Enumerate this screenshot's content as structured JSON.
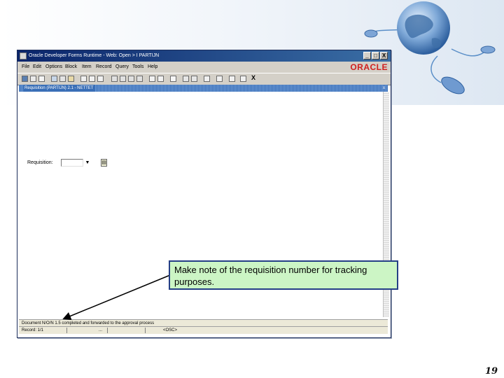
{
  "window": {
    "title": "Oracle Developer Forms Runtime - Web: Open > I PARTIJN",
    "controls": [
      "_",
      "□",
      "X"
    ],
    "menu": [
      "File",
      "Edit",
      "Options",
      "Block",
      "Item",
      "Record",
      "Query",
      "Tools",
      "Help"
    ],
    "brand": "ORACLE",
    "toolbar_x": "X",
    "inner_title": "Requisition (PARTIJN) 2.1 - NETTET",
    "inner_close": "x"
  },
  "form": {
    "requisition_label": "Requisition:",
    "requisition_value": "",
    "dropdown_glyph": "▼",
    "lov_glyph": "▤"
  },
  "status": {
    "message": "Document N/O/N 1.5 completed and forwarded to the approval process",
    "record": "Record: 1/1",
    "record_extra": "...",
    "mode": "<OSC>"
  },
  "callout": {
    "text": "Make note of the requisition number for tracking purposes."
  },
  "slide": {
    "page_number": "19"
  },
  "colors": {
    "titlebar": "#0a246a",
    "callout_fill": "#ccf5c5",
    "callout_border": "#253f86",
    "oracle_red": "#d0201f"
  }
}
